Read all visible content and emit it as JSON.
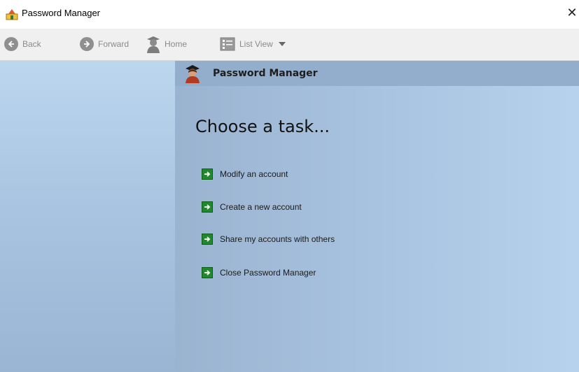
{
  "window": {
    "title": "Password Manager",
    "app_icon": "password-manager-app-icon",
    "close_glyph": "✕"
  },
  "toolbar": {
    "back_label": "Back",
    "forward_label": "Forward",
    "home_label": "Home",
    "listview_label": "List View"
  },
  "main": {
    "header_title": "Password Manager",
    "heading": "Choose a task...",
    "tasks": [
      {
        "label": "Modify an account"
      },
      {
        "label": "Create a new account"
      },
      {
        "label": "Share my accounts with others"
      },
      {
        "label": "Close Password Manager"
      }
    ]
  },
  "colors": {
    "task_arrow": "#1f8a2a",
    "toolbar_icon": "#8f8f8f",
    "header_band": "#93adcc"
  }
}
